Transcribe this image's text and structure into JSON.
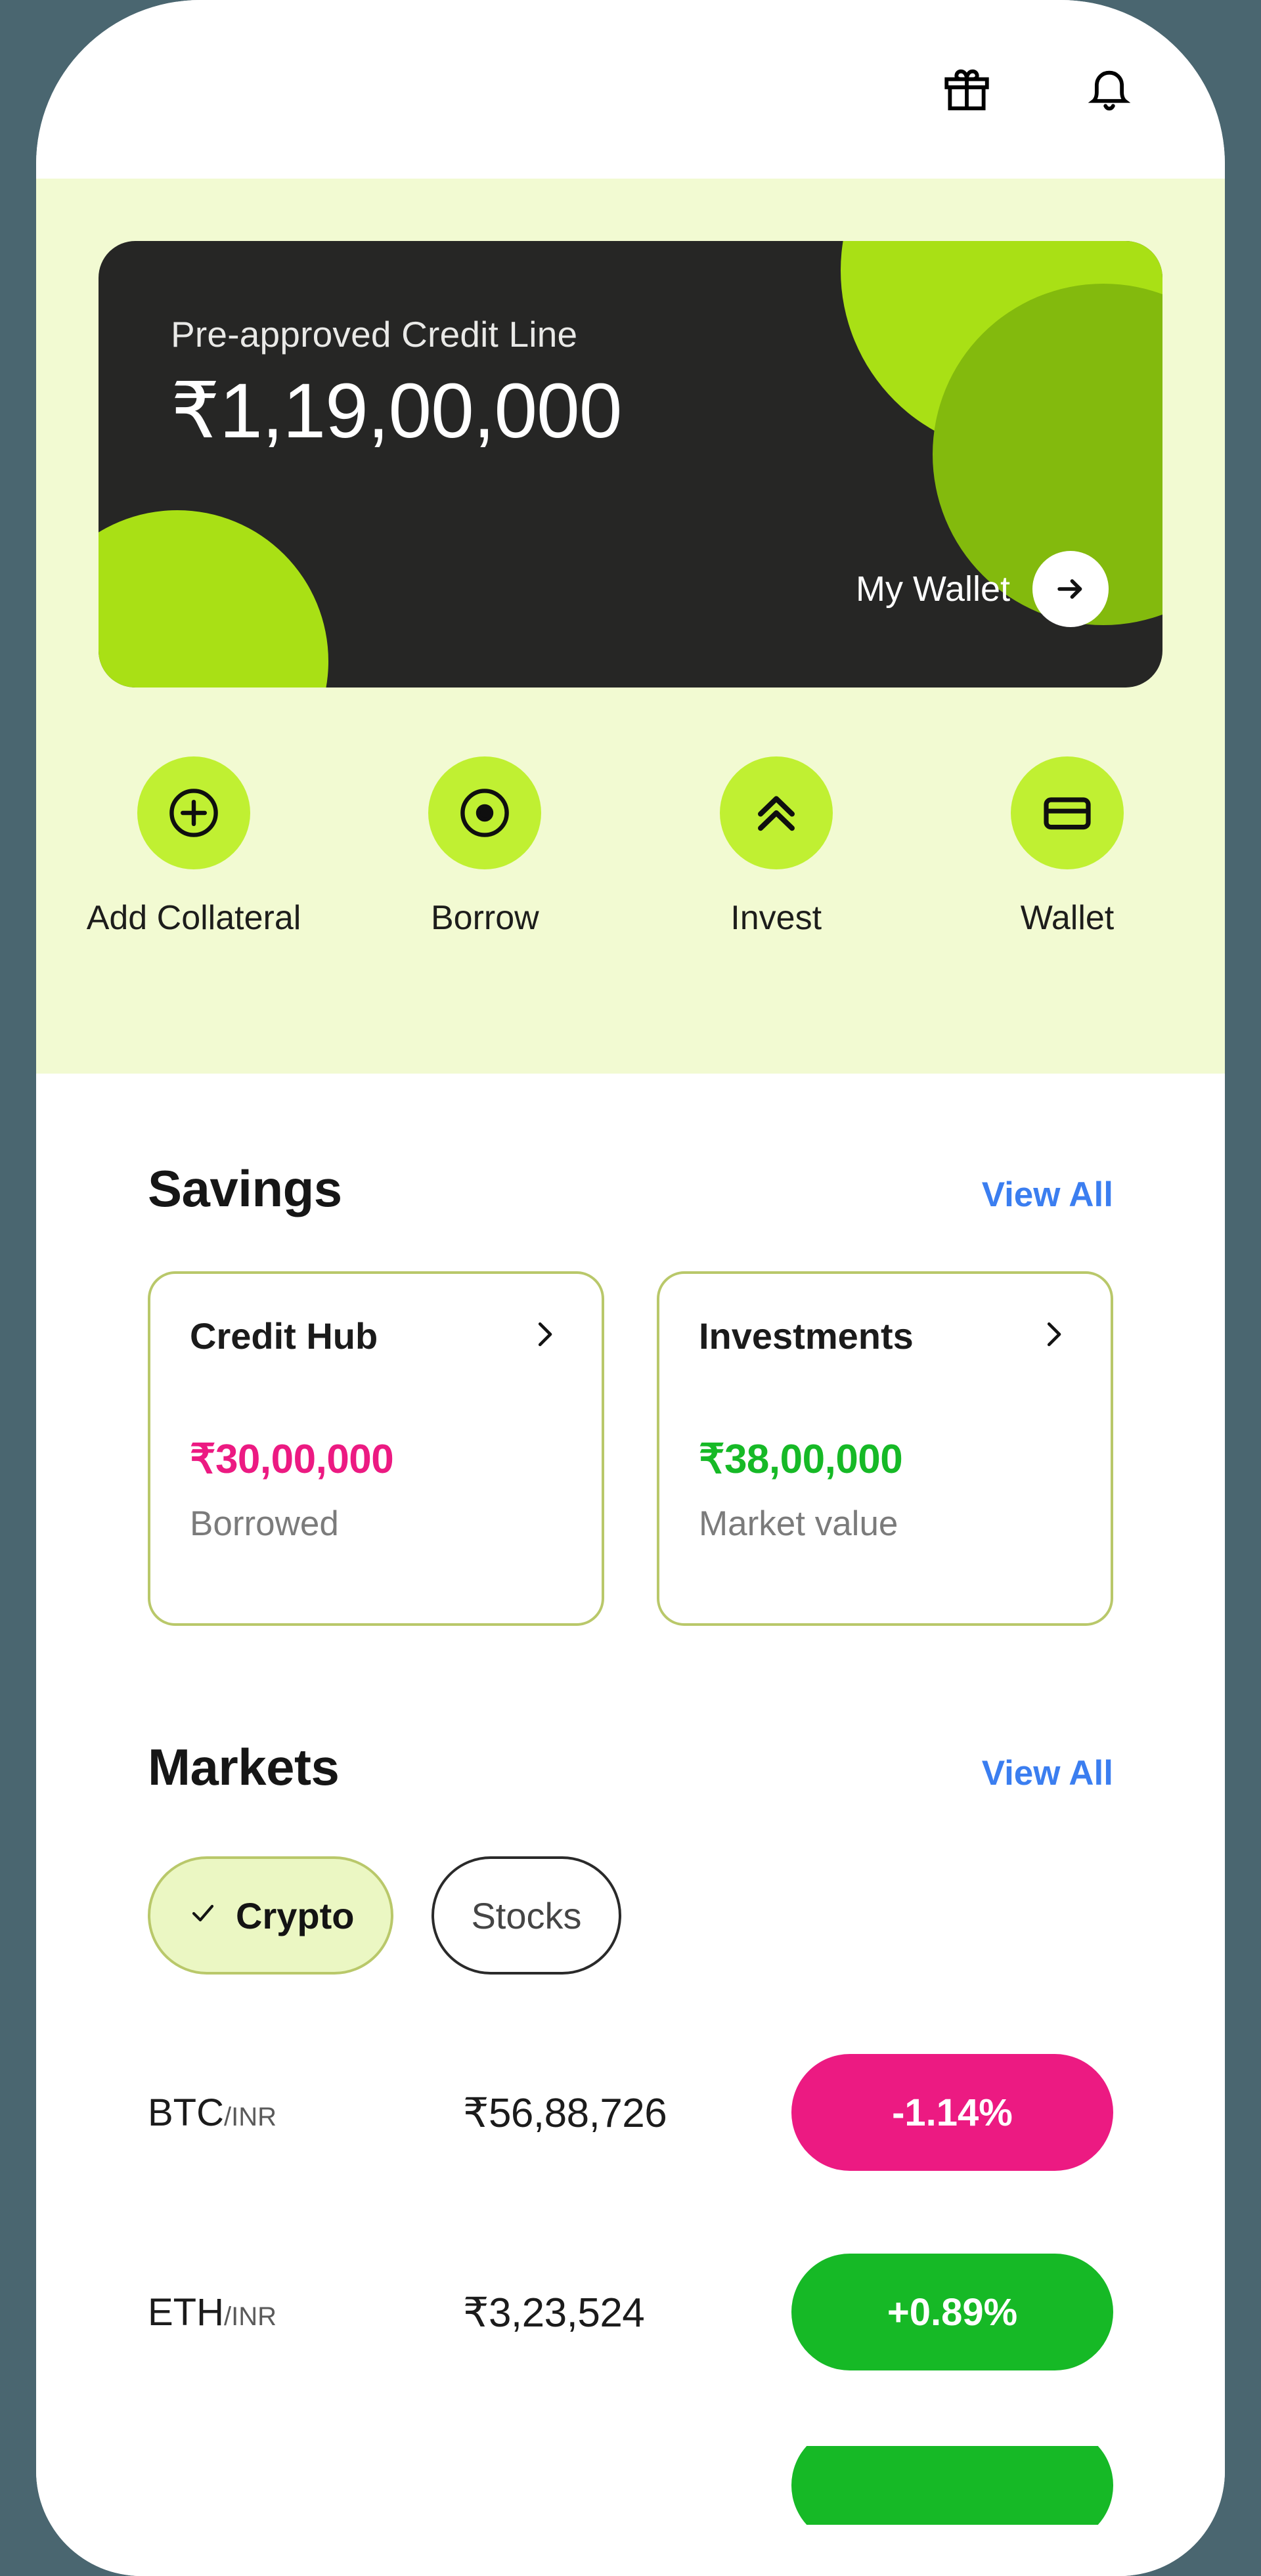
{
  "topbar": {
    "gift_icon": "gift-icon",
    "bell_icon": "bell-icon"
  },
  "credit_card": {
    "label": "Pre-approved Credit Line",
    "amount": "₹1,19,00,000",
    "wallet_label": "My Wallet",
    "arrow_icon": "arrow-right-icon",
    "bg_color": "#262625",
    "accent_lime": "#a9e015",
    "accent_olive": "#83ba0d"
  },
  "quick_actions": [
    {
      "label": "Add Collateral",
      "icon": "plus-circle-icon"
    },
    {
      "label": "Borrow",
      "icon": "target-circle-icon"
    },
    {
      "label": "Invest",
      "icon": "double-chevron-up-icon"
    },
    {
      "label": "Wallet",
      "icon": "card-icon"
    }
  ],
  "savings": {
    "title": "Savings",
    "view_all": "View All",
    "cards": [
      {
        "title": "Credit Hub",
        "value": "₹30,00,000",
        "value_color": "#ec1a82",
        "subtitle": "Borrowed",
        "chevron_icon": "chevron-right-icon"
      },
      {
        "title": "Investments",
        "value": "₹38,00,000",
        "value_color": "#16b926",
        "subtitle": "Market value",
        "chevron_icon": "chevron-right-icon"
      }
    ]
  },
  "markets": {
    "title": "Markets",
    "view_all": "View All",
    "tabs": [
      {
        "label": "Crypto",
        "selected": true,
        "check_icon": "check-icon"
      },
      {
        "label": "Stocks",
        "selected": false,
        "check_icon": ""
      }
    ],
    "rows": [
      {
        "base": "BTC",
        "quote": "/INR",
        "price": "₹56,88,726",
        "change": "-1.14%",
        "direction": "down"
      },
      {
        "base": "ETH",
        "quote": "/INR",
        "price": "₹3,23,524",
        "change": "+0.89%",
        "direction": "up"
      }
    ]
  },
  "theme": {
    "page_bg": "#4a6670",
    "hero_bg": "#f2fad2",
    "accent_green": "#c0f032",
    "link_blue": "#3b7ef0",
    "positive": "#16b926",
    "negative": "#ec1a82"
  }
}
